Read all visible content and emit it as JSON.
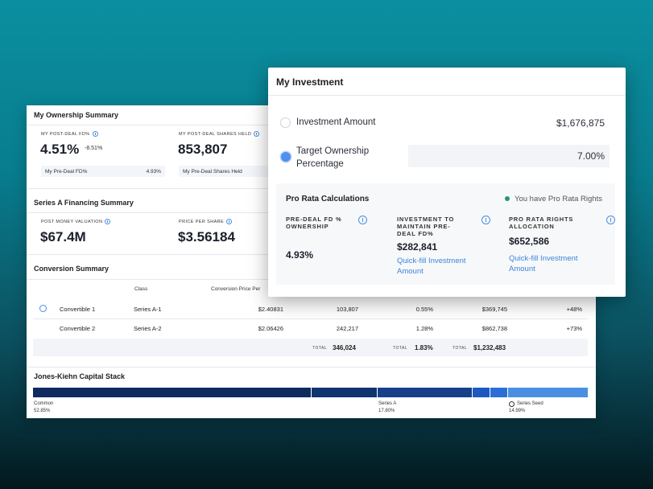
{
  "ownership": {
    "title": "My Ownership Summary",
    "post_deal_label": "MY POST-DEAL FD%",
    "post_deal_value": "4.51%",
    "post_deal_change": "-8.51%",
    "pre_deal_label": "My Pre-Deal FD%",
    "pre_deal_value": "4.93%",
    "shares_label": "MY POST-DEAL SHARES HELD",
    "shares_value": "853,807",
    "pre_shares_label": "My Pre-Deal Shares Held"
  },
  "financing": {
    "title": "Series A Financing Summary",
    "pmv_label": "POST MONEY VALUATION",
    "pmv_value": "$67.4M",
    "pps_label": "PRICE PER SHARE",
    "pps_value": "$3.56184"
  },
  "conversion": {
    "title": "Conversion Summary",
    "headers": {
      "class": "Class",
      "price": "Conversion Price Per"
    },
    "rows": [
      {
        "name": "Convertible 1",
        "class": "Series A-1",
        "price": "$2.40831",
        "shares": "103,807",
        "pct": "0.55%",
        "amount": "$369,745",
        "change": "+48%"
      },
      {
        "name": "Convertible 2",
        "class": "Series A-2",
        "price": "$2.06426",
        "shares": "242,217",
        "pct": "1.28%",
        "amount": "$862,738",
        "change": "+73%"
      }
    ],
    "total_label": "TOTAL",
    "total_shares": "346,024",
    "total_pct": "1.83%",
    "total_amount": "$1,232,483"
  },
  "capital_stack": {
    "title": "Jones-Kiehn Capital Stack",
    "segments": [
      {
        "label": "Common",
        "pct": "52.85%",
        "color": "#0f2a5e"
      },
      {
        "label": "Series A",
        "pct": "17.80%",
        "color": "#143b80"
      },
      {
        "label": "Series Seed",
        "pct": "14.99%",
        "color": "#4a90e2"
      }
    ],
    "colors": {
      "common": "#0f2a5e",
      "series_a_dark": "#16408a",
      "series_a_light": "#1d58c0",
      "seed": "#4a90e2"
    }
  },
  "investment": {
    "title": "My Investment",
    "amount_label": "Investment Amount",
    "amount_value": "$1,676,875",
    "target_label_1": "Target Ownership",
    "target_label_2": "Percentage",
    "target_value": "7.00%",
    "selected_option": "Target Ownership Percentage"
  },
  "pro_rata": {
    "title": "Pro Rata Calculations",
    "rights_text": "You have Pro Rata Rights",
    "col1_label": "PRE-DEAL FD % OWNERSHIP",
    "col1_value": "4.93%",
    "col2_label": "INVESTMENT TO MAINTAIN PRE-DEAL FD%",
    "col2_value": "$282,841",
    "col2_link": "Quick-fill Investment Amount",
    "col3_label": "PRO RATA RIGHTS ALLOCATION",
    "col3_value": "$652,586",
    "col3_link": "Quick-fill Investment Amount"
  }
}
